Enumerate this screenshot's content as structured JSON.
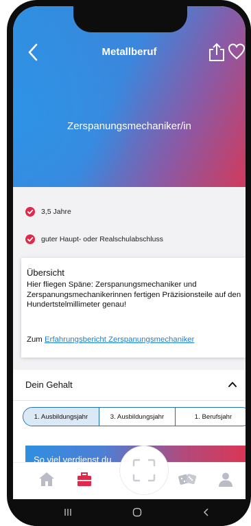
{
  "header": {
    "title": "Metallberuf",
    "back_icon": "chevron-left-icon",
    "share_icon": "share-icon",
    "favorite_icon": "heart-outline-icon"
  },
  "hero": {
    "title": "Zerspanungsmechaniker/in"
  },
  "facts": [
    {
      "icon": "check-badge-icon",
      "text": "3,5 Jahre"
    },
    {
      "icon": "check-badge-icon",
      "text": "guter Haupt- oder Realschulabschluss"
    }
  ],
  "overview": {
    "title": "Übersicht",
    "text": "Hier fliegen Späne: Zerspanungsmechaniker und Zerspanungsmechanikerinnen fertigen Präzisionsteile auf den Hundertstelmillimeter genau!",
    "link_prefix": "Zum ",
    "link_text": "Erfahrungsbericht Zerspanungsmechaniker"
  },
  "salary": {
    "title": "Dein Gehalt",
    "toggle_icon": "chevron-up-icon",
    "segments": [
      {
        "label": "1. Ausbildungsjahr",
        "selected": true
      },
      {
        "label": "3. Ausbildungsjahr",
        "selected": false
      },
      {
        "label": "1. Berufsjahr",
        "selected": false
      }
    ],
    "banner_text": "So viel verdienst du"
  },
  "tabbar": {
    "items": [
      {
        "icon": "home-icon",
        "active": false
      },
      {
        "icon": "briefcase-icon",
        "active": true
      },
      {
        "icon": "scan-icon",
        "active": false
      },
      {
        "icon": "dice-icon",
        "active": false
      },
      {
        "icon": "person-icon",
        "active": false
      }
    ]
  },
  "colors": {
    "accent_red": "#e0294a",
    "accent_blue": "#1d7fd8",
    "gradient_start": "#2f8fe0",
    "gradient_end": "#d13a5c"
  }
}
